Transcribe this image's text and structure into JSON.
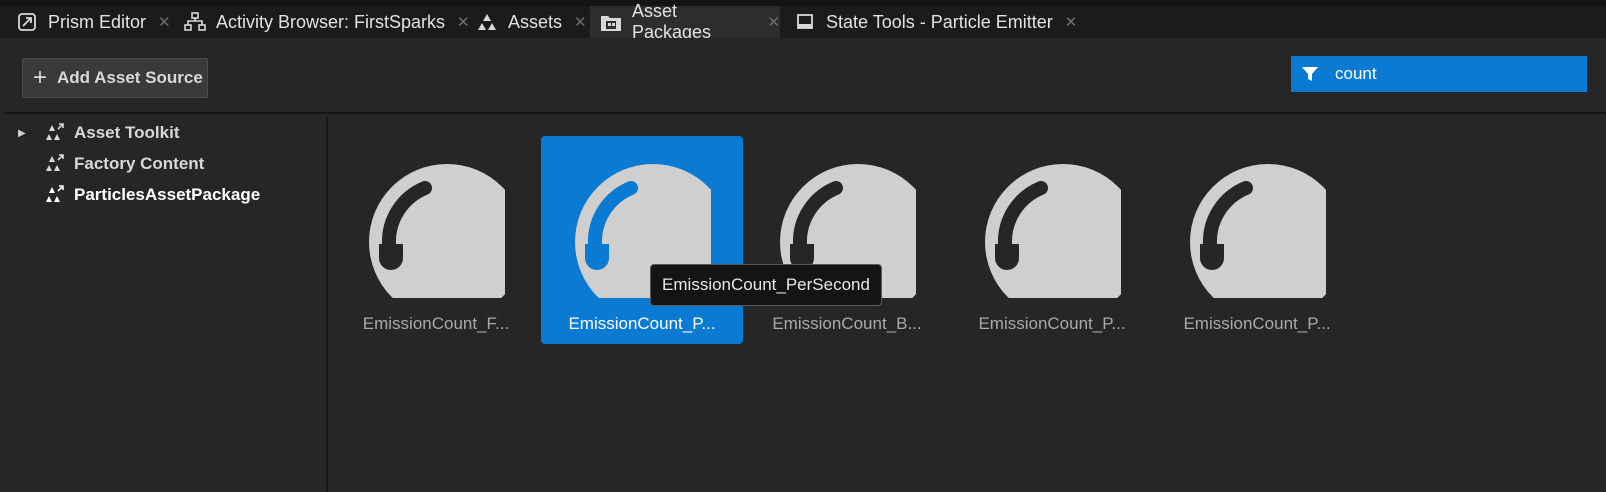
{
  "tabs": [
    {
      "label": "Prism Editor",
      "icon": "prism-editor-icon",
      "active": false
    },
    {
      "label": "Activity Browser: FirstSparks",
      "icon": "activity-browser-icon",
      "active": false
    },
    {
      "label": "Assets",
      "icon": "assets-icon",
      "active": false
    },
    {
      "label": "Asset Packages",
      "icon": "asset-packages-icon",
      "active": true
    },
    {
      "label": "State Tools - Particle Emitter",
      "icon": "state-tools-icon",
      "active": false
    }
  ],
  "toolbar": {
    "add_label": "Add Asset Source",
    "search_value": "count"
  },
  "tree": [
    {
      "label": "Asset Toolkit",
      "expandable": true,
      "selected": false
    },
    {
      "label": "Factory Content",
      "expandable": false,
      "selected": false
    },
    {
      "label": "ParticlesAssetPackage",
      "expandable": false,
      "selected": true
    }
  ],
  "assets": [
    {
      "label": "EmissionCount_F...",
      "selected": false
    },
    {
      "label": "EmissionCount_P...",
      "selected": true
    },
    {
      "label": "EmissionCount_B...",
      "selected": false
    },
    {
      "label": "EmissionCount_P...",
      "selected": false
    },
    {
      "label": "EmissionCount_P...",
      "selected": false
    }
  ],
  "tooltip": "EmissionCount_PerSecond",
  "colors": {
    "accent": "#0a7ad3",
    "background": "#262626",
    "tabbar": "#1b1b1b",
    "gauge_light": "#cfcfcf",
    "gauge_dark": "#262626"
  }
}
